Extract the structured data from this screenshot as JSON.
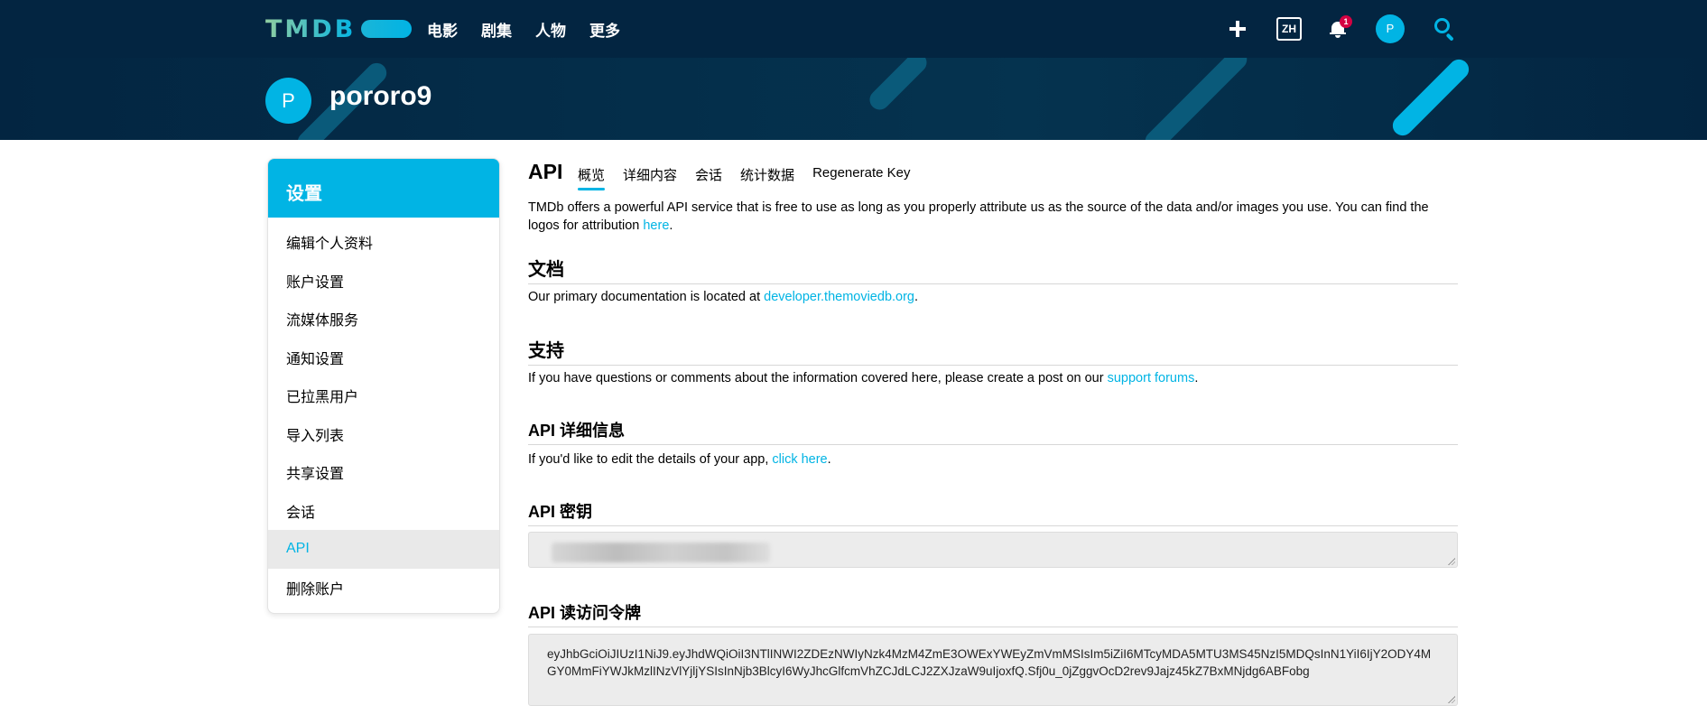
{
  "nav": {
    "logo_text": "TMDB",
    "menu": [
      "电影",
      "剧集",
      "人物",
      "更多"
    ],
    "language": "ZH",
    "notification_count": "1",
    "avatar_initial": "P"
  },
  "profile": {
    "avatar_initial": "P",
    "username": "pororo9"
  },
  "sidebar": {
    "title": "设置",
    "items": [
      {
        "label": "编辑个人资料",
        "active": false
      },
      {
        "label": "账户设置",
        "active": false
      },
      {
        "label": "流媒体服务",
        "active": false
      },
      {
        "label": "通知设置",
        "active": false
      },
      {
        "label": "已拉黑用户",
        "active": false
      },
      {
        "label": "导入列表",
        "active": false
      },
      {
        "label": "共享设置",
        "active": false
      },
      {
        "label": "会话",
        "active": false
      },
      {
        "label": "API",
        "active": true
      },
      {
        "label": "删除账户",
        "active": false
      }
    ]
  },
  "main": {
    "title": "API",
    "tabs": [
      {
        "label": "概览",
        "active": true
      },
      {
        "label": "详细内容",
        "active": false
      },
      {
        "label": "会话",
        "active": false
      },
      {
        "label": "统计数据",
        "active": false
      },
      {
        "label": "Regenerate Key",
        "active": false
      }
    ],
    "intro_text": "TMDb offers a powerful API service that is free to use as long as you properly attribute us as the source of the data and/or images you use. You can find the logos for attribution ",
    "intro_link": "here",
    "docs": {
      "heading": "文档",
      "text": "Our primary documentation is located at ",
      "link": "developer.themoviedb.org"
    },
    "support": {
      "heading": "支持",
      "text": "If you have questions or comments about the information covered here, please create a post on our ",
      "link": "support forums"
    },
    "details": {
      "heading": "API 详细信息",
      "text": "If you'd like to edit the details of your app, ",
      "link": "click here"
    },
    "api_key": {
      "heading": "API 密钥"
    },
    "read_token": {
      "heading": "API 读访问令牌",
      "value": "eyJhbGciOiJIUzI1NiJ9.eyJhdWQiOiI3NTlINWI2ZDEzNWIyNzk4MzM4ZmE3OWExYWEyZmVmMSIsIm5iZiI6MTcyMDA5MTU3MS45NzI5MDQsInN1YiI6IjY2ODY4MGY0MmFiYWJkMzlINzVlYjljYSIsInNjb3BlcyI6WyJhcGlfcmVhZCJdLCJ2ZXJzaW9uIjoxfQ.Sfj0u_0jZggvOcD2rev9Jajz45kZ7BxMNjdg6ABFobg"
    }
  },
  "colors": {
    "nav_bg": "#032541",
    "accent": "#01b4e4",
    "badge": "#d40242"
  }
}
